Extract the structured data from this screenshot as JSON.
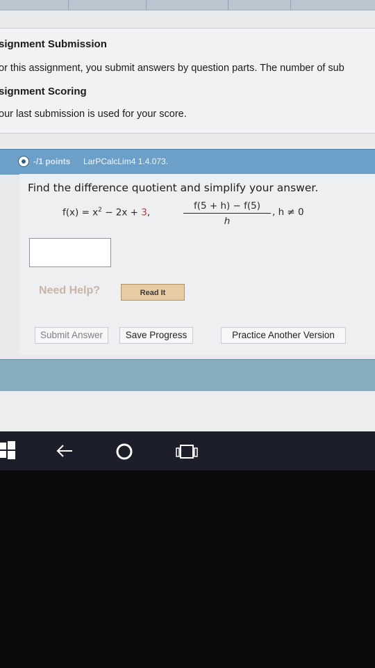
{
  "assignment": {
    "submission_heading": "signment Submission",
    "submission_text": "or this assignment, you submit answers by question parts. The number of sub",
    "scoring_heading": "signment Scoring",
    "scoring_text": "our last submission is used for your score."
  },
  "question": {
    "points_label": "-/1 points",
    "source_label": "LarPCalcLim4 1.4.073.",
    "prompt": "Find the difference quotient and simplify your answer.",
    "function_lhs": "f(x) = x",
    "function_exp": "2",
    "function_mid": " − 2x + ",
    "function_const": "3",
    "function_comma": ",",
    "fraction_numerator": "f(5 + h) − f(5)",
    "fraction_denominator": "h",
    "condition": ", h ≠ 0",
    "answer_value": ""
  },
  "help": {
    "need_help_label": "Need Help?",
    "read_it_label": "Read It"
  },
  "actions": {
    "submit_label": "Submit Answer",
    "save_label": "Save Progress",
    "practice_label": "Practice Another Version"
  },
  "taskbar": {
    "icons": [
      "windows-start-icon",
      "back-arrow-icon",
      "cortana-circle-icon",
      "task-view-icon"
    ]
  },
  "colors": {
    "question_bar": "#6da0c9",
    "read_it_button": "#e7cba3",
    "taskbar": "#1c1f29"
  }
}
